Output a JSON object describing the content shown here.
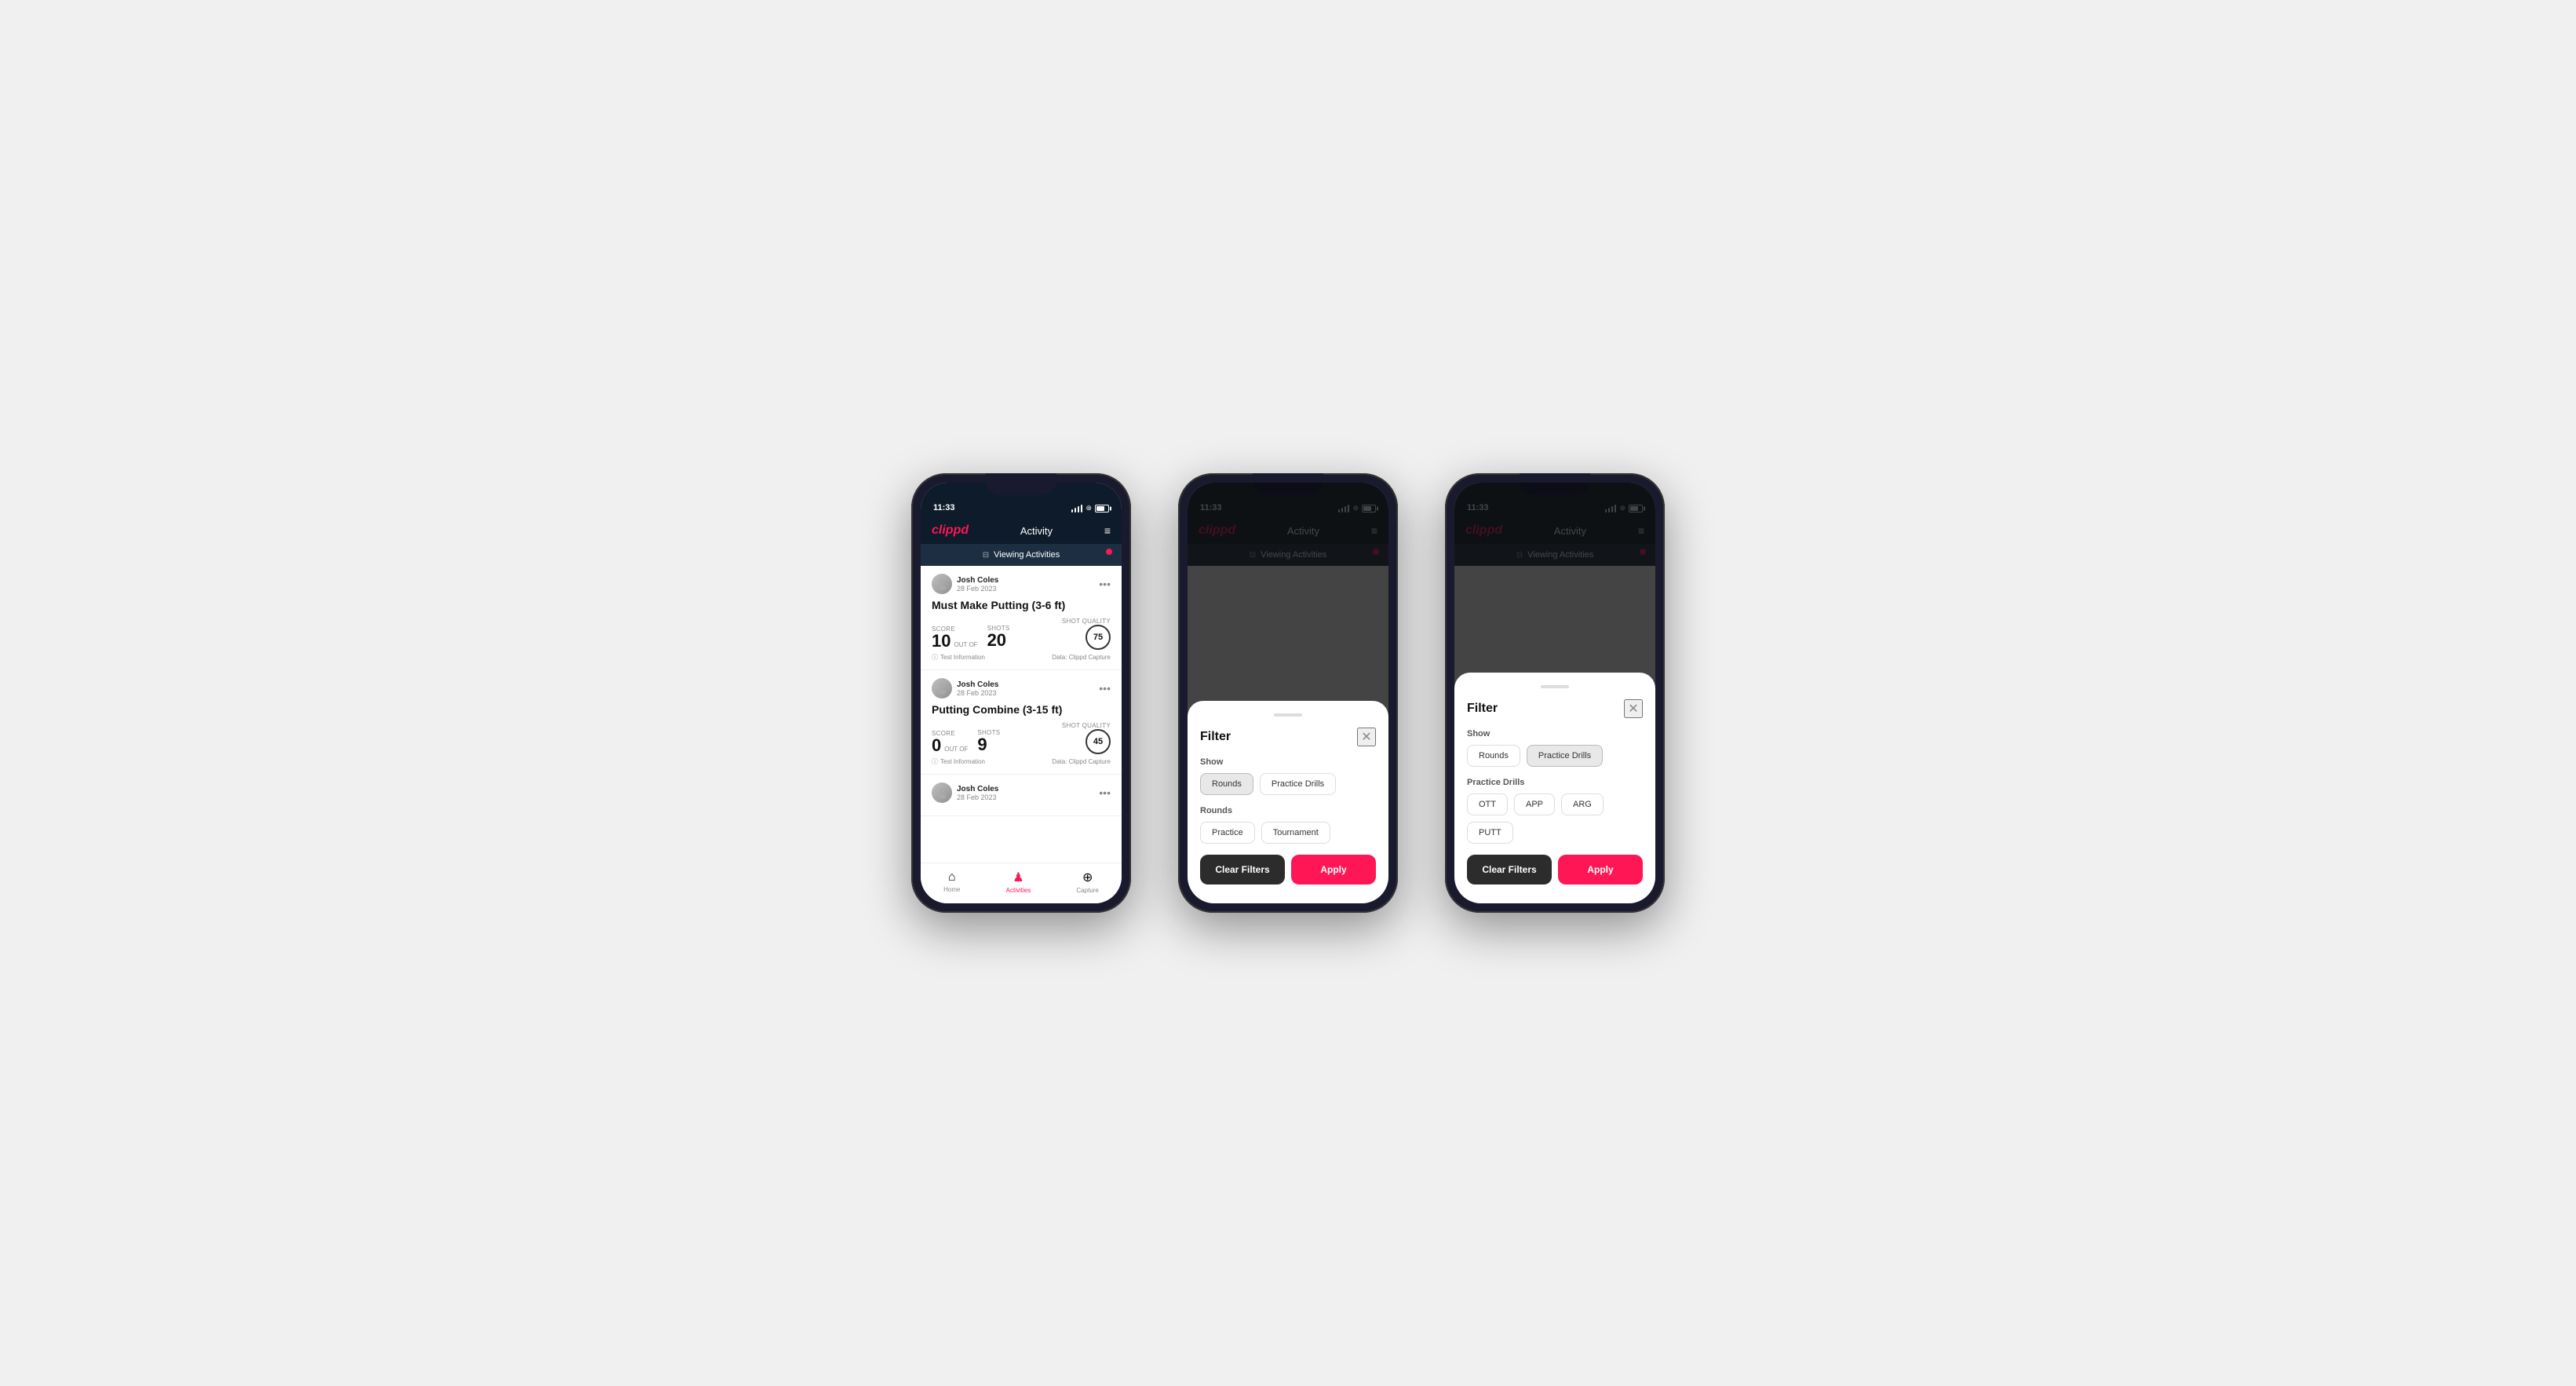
{
  "phones": [
    {
      "id": "phone1",
      "statusBar": {
        "time": "11:33",
        "batteryLevel": "33"
      },
      "header": {
        "logo": "clippd",
        "title": "Activity",
        "menuIcon": "≡"
      },
      "viewingBar": {
        "text": "Viewing Activities",
        "hasRedDot": true
      },
      "activities": [
        {
          "userName": "Josh Coles",
          "userDate": "28 Feb 2023",
          "title": "Must Make Putting (3-6 ft)",
          "scoreLabel": "Score",
          "scoreValue": "10",
          "outOfLabel": "OUT OF",
          "shotsLabel": "Shots",
          "shotsValue": "20",
          "shotQualityLabel": "Shot Quality",
          "shotQualityValue": "75",
          "testInfo": "Test Information",
          "dataSource": "Data: Clippd Capture"
        },
        {
          "userName": "Josh Coles",
          "userDate": "28 Feb 2023",
          "title": "Putting Combine (3-15 ft)",
          "scoreLabel": "Score",
          "scoreValue": "0",
          "outOfLabel": "OUT OF",
          "shotsLabel": "Shots",
          "shotsValue": "9",
          "shotQualityLabel": "Shot Quality",
          "shotQualityValue": "45",
          "testInfo": "Test Information",
          "dataSource": "Data: Clippd Capture"
        },
        {
          "userName": "Josh Coles",
          "userDate": "28 Feb 2023",
          "title": "",
          "scoreLabel": "",
          "scoreValue": "",
          "outOfLabel": "",
          "shotsLabel": "",
          "shotsValue": "",
          "shotQualityLabel": "",
          "shotQualityValue": "",
          "testInfo": "",
          "dataSource": ""
        }
      ],
      "bottomNav": [
        {
          "label": "Home",
          "icon": "⌂",
          "active": false
        },
        {
          "label": "Activities",
          "icon": "♟",
          "active": true
        },
        {
          "label": "Capture",
          "icon": "⊕",
          "active": false
        }
      ]
    },
    {
      "id": "phone2",
      "statusBar": {
        "time": "11:33",
        "batteryLevel": "33"
      },
      "header": {
        "logo": "clippd",
        "title": "Activity",
        "menuIcon": "≡"
      },
      "viewingBar": {
        "text": "Viewing Activities",
        "hasRedDot": true
      },
      "filter": {
        "title": "Filter",
        "showLabel": "Show",
        "showOptions": [
          {
            "label": "Rounds",
            "active": true
          },
          {
            "label": "Practice Drills",
            "active": false
          }
        ],
        "roundsLabel": "Rounds",
        "roundsOptions": [
          {
            "label": "Practice",
            "active": false
          },
          {
            "label": "Tournament",
            "active": false
          }
        ],
        "clearLabel": "Clear Filters",
        "applyLabel": "Apply"
      }
    },
    {
      "id": "phone3",
      "statusBar": {
        "time": "11:33",
        "batteryLevel": "33"
      },
      "header": {
        "logo": "clippd",
        "title": "Activity",
        "menuIcon": "≡"
      },
      "viewingBar": {
        "text": "Viewing Activities",
        "hasRedDot": true
      },
      "filter": {
        "title": "Filter",
        "showLabel": "Show",
        "showOptions": [
          {
            "label": "Rounds",
            "active": false
          },
          {
            "label": "Practice Drills",
            "active": true
          }
        ],
        "drillsLabel": "Practice Drills",
        "drillsOptions": [
          {
            "label": "OTT",
            "active": false
          },
          {
            "label": "APP",
            "active": false
          },
          {
            "label": "ARG",
            "active": false
          },
          {
            "label": "PUTT",
            "active": false
          }
        ],
        "clearLabel": "Clear Filters",
        "applyLabel": "Apply"
      }
    }
  ]
}
